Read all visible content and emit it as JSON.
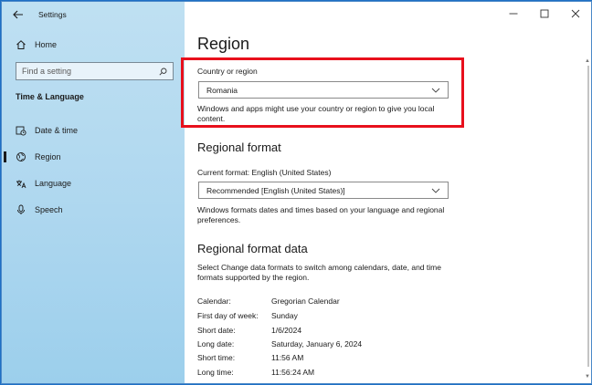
{
  "window": {
    "title": "Settings"
  },
  "sidebar": {
    "home": "Home",
    "search_placeholder": "Find a setting",
    "section": "Time & Language",
    "items": [
      {
        "label": "Date & time",
        "icon": "calendar-clock-icon"
      },
      {
        "label": "Region",
        "icon": "globe-icon",
        "active": true
      },
      {
        "label": "Language",
        "icon": "language-icon"
      },
      {
        "label": "Speech",
        "icon": "microphone-icon"
      }
    ]
  },
  "main": {
    "title": "Region",
    "country": {
      "label": "Country or region",
      "selected": "Romania",
      "description": "Windows and apps might use your country or region to give you local content."
    },
    "regional_format": {
      "heading": "Regional format",
      "current_label": "Current format: English (United States)",
      "selected": "Recommended [English (United States)]",
      "description": "Windows formats dates and times based on your language and regional preferences."
    },
    "format_data": {
      "heading": "Regional format data",
      "description": "Select Change data formats to switch among calendars, date, and time formats supported by the region.",
      "rows": [
        {
          "key": "Calendar:",
          "value": "Gregorian Calendar"
        },
        {
          "key": "First day of week:",
          "value": "Sunday"
        },
        {
          "key": "Short date:",
          "value": "1/6/2024"
        },
        {
          "key": "Long date:",
          "value": "Saturday, January 6, 2024"
        },
        {
          "key": "Short time:",
          "value": "11:56 AM"
        },
        {
          "key": "Long time:",
          "value": "11:56:24 AM"
        }
      ]
    }
  },
  "colors": {
    "highlight": "#e8101c",
    "sidebar": "#aed7ef",
    "desktop": "#1e6fc4"
  }
}
